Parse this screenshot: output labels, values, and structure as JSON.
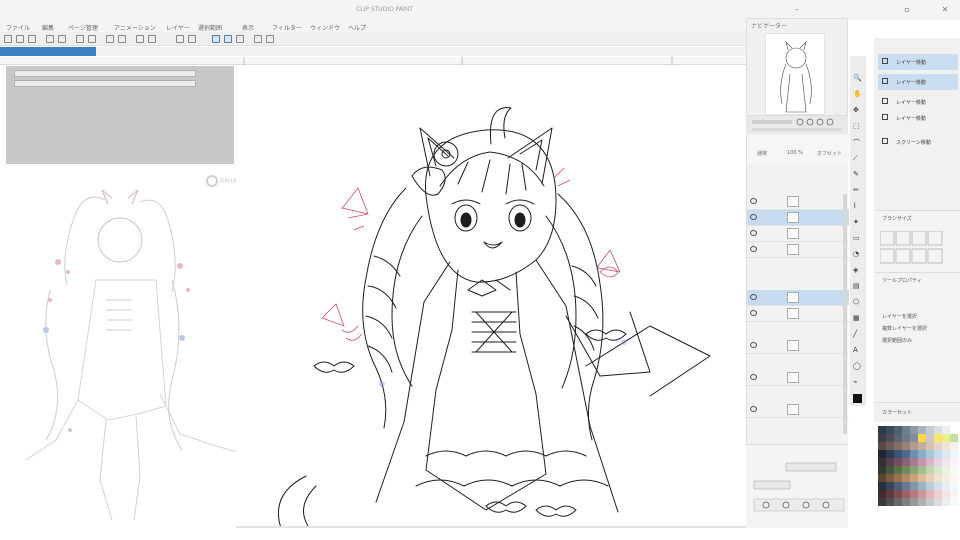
{
  "window": {
    "title": "CLIP STUDIO PAINT"
  },
  "menu": {
    "items": [
      "ファイル",
      "編集",
      "ページ管理",
      "アニメーション",
      "レイヤー",
      "選択範囲",
      "表示",
      "フィルター",
      "ウィンドウ",
      "ヘルプ"
    ]
  },
  "panels": {
    "navigator_title": "ナビゲーター",
    "subtool_rows": [
      "",
      ""
    ],
    "layer_labels": [
      "通常",
      "100 %",
      "オフセット"
    ],
    "subtool_items": [
      "レイヤー移動",
      "レイヤー移動",
      "レイヤー移動",
      "レイヤー移動"
    ],
    "subtool_extra": "スクリーン移動",
    "brushsize_label": "ブラシサイズ",
    "toolprop_title": "ツールプロパティ",
    "toolprop_lines": [
      "レイヤーを選択",
      "複数レイヤーを選択",
      "選択範囲のみ"
    ],
    "colorset_title": "カラーセット",
    "layer_names": [
      "",
      "",
      "",
      "",
      "",
      "",
      "",
      "",
      ""
    ]
  },
  "watermark": {
    "text": "BAHAMUT"
  },
  "colors": {
    "accent": "#3f82c4",
    "selection": "#c6dbef",
    "panel_bg": "#f2f2f2",
    "subpanel_bg": "#c8c8c8",
    "sketch_red": "#c85060",
    "sketch_blue": "#6a8fd0",
    "line": "#1e1e1e"
  },
  "icons": [
    "minimize-icon",
    "maximize-icon",
    "close-icon",
    "eye-icon",
    "folder-icon",
    "pen-icon",
    "brush-icon",
    "eraser-icon",
    "selection-icon",
    "zoom-icon",
    "hand-icon",
    "move-icon"
  ],
  "palette": [
    "#2d3a48",
    "#3a4b5c",
    "#4e6072",
    "#6e7f90",
    "#8c9aa8",
    "#a7b4bf",
    "#c4ccd4",
    "#d9dfe4",
    "#eceff1",
    "#ffffff",
    "#3e3d46",
    "#4f4c5a",
    "#5f6270",
    "#6f7887",
    "#7e8e9f",
    "#ffd54a",
    "#c9c9c9",
    "#f7e76b",
    "#e8f08a",
    "#bfe39a",
    "#5a4a46",
    "#6e5c56",
    "#836c64",
    "#9b8276",
    "#b49a8c",
    "#c6ad9d",
    "#d9c1b2",
    "#e9d3c6",
    "#f2e1d8",
    "#f8efe9",
    "#1c2832",
    "#2b3e50",
    "#3a5570",
    "#496c90",
    "#6a8fb0",
    "#8aaec8",
    "#a7c6da",
    "#c4dbe9",
    "#dbeaf2",
    "#eef5f9",
    "#3a2d36",
    "#56404d",
    "#704f61",
    "#8d6279",
    "#a97a93",
    "#c497ae",
    "#d8b5c7",
    "#e8d0dc",
    "#f3e4ec",
    "#faf2f6",
    "#2f3d2c",
    "#42583c",
    "#57724d",
    "#6d8c5f",
    "#87a677",
    "#a2bf94",
    "#bfd6b2",
    "#d7e7cd",
    "#e8f1e2",
    "#f5f9f1",
    "#5c4530",
    "#7a5c40",
    "#977252",
    "#b28a66",
    "#c9a27d",
    "#dabb98",
    "#e7d0b3",
    "#f0e1cc",
    "#f6ede0",
    "#fbf6ef",
    "#243240",
    "#34475a",
    "#4b6076",
    "#647b91",
    "#7f96ab",
    "#9bb1c4",
    "#b8cbdb",
    "#d2e0ea",
    "#e5eef4",
    "#f3f7fa",
    "#442a2e",
    "#603a40",
    "#7e4c53",
    "#9c6168",
    "#b87b81",
    "#cf979c",
    "#e0b5b8",
    "#eccfd1",
    "#f5e4e5",
    "#fbf3f3",
    "#3a3a3a",
    "#505050",
    "#686868",
    "#808080",
    "#989898",
    "#b0b0b0",
    "#c8c8c8",
    "#dcdcdc",
    "#ececec",
    "#f8f8f8"
  ]
}
